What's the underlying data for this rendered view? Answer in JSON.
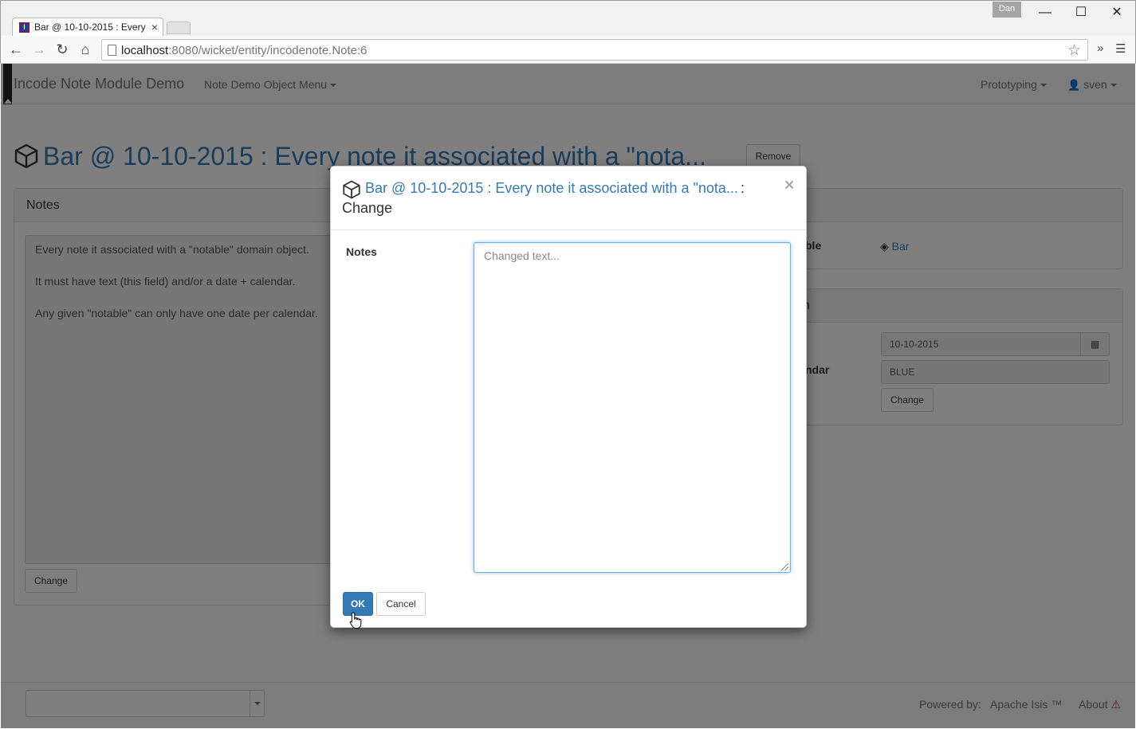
{
  "browser": {
    "tab_title": "Bar @ 10-10-2015 : Every",
    "tab_close": "×",
    "user_badge": "Dan",
    "window_controls": [
      "—",
      "☐",
      "✕"
    ],
    "url_host": "localhost",
    "url_path": ":8080/wicket/entity/incodenote.Note:6",
    "extensions": "»",
    "menu": "☰"
  },
  "navbar": {
    "brand": "Incode Note Module Demo",
    "menu_label": "Note Demo Object Menu",
    "prototyping_label": "Prototyping",
    "user_label": "sven"
  },
  "page": {
    "title": "Bar @ 10-10-2015 : Every note it associated with a \"nota...",
    "remove_label": "Remove"
  },
  "notes_panel": {
    "heading": "Notes",
    "paragraphs": [
      "Every note it associated with a \"notable\" domain object.",
      "It must have text (this field) and/or a date + calendar.",
      "Any given \"notable\" can only have one date per calendar."
    ],
    "change_label": "Change"
  },
  "right_panels": {
    "notable_heading_partial": "t",
    "notable_label_partial": "ble",
    "notable_value": "Bar",
    "date_heading_partial": "n",
    "calendar_label_partial": "ndar",
    "date_value": "10-10-2015",
    "calendar_value": "BLUE",
    "change_label": "Change"
  },
  "footer": {
    "powered_by": "Powered by:",
    "apache_isis": "Apache Isis ™",
    "about": "About"
  },
  "modal": {
    "title_link": "Bar @ 10-10-2015 : Every note it associated with a \"nota...",
    "title_sep": ":",
    "title_action": "Change",
    "close": "×",
    "field_label": "Notes",
    "textarea_placeholder": "Changed text...",
    "ok_label": "OK",
    "cancel_label": "Cancel"
  },
  "colors": {
    "link": "#337ab7",
    "primary_button": "#337ab7",
    "backdrop": "rgba(0,0,0,0.5)"
  }
}
